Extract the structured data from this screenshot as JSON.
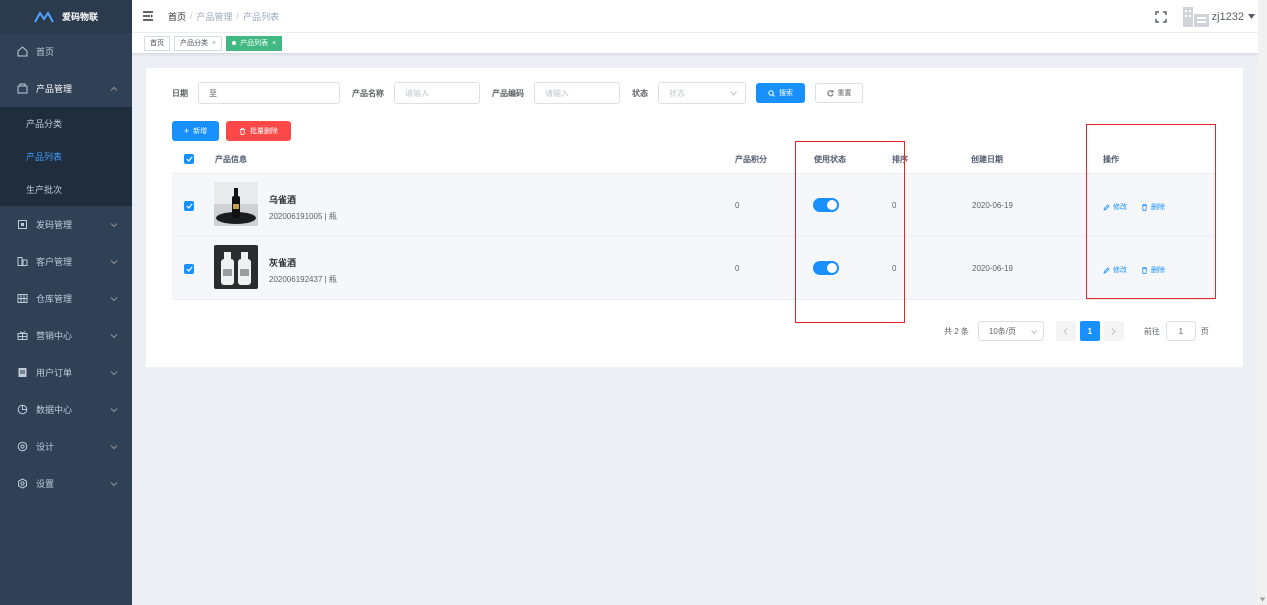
{
  "app": {
    "logo_text": "爱码物联"
  },
  "sidebar": {
    "items": [
      {
        "label": "首页",
        "icon": "home-icon"
      },
      {
        "label": "产品管理",
        "icon": "product-icon"
      },
      {
        "label": "发码管理",
        "icon": "code-icon"
      },
      {
        "label": "客户管理",
        "icon": "customer-icon"
      },
      {
        "label": "仓库管理",
        "icon": "warehouse-icon"
      },
      {
        "label": "营销中心",
        "icon": "marketing-icon"
      },
      {
        "label": "用户订单",
        "icon": "order-icon"
      },
      {
        "label": "数据中心",
        "icon": "data-icon"
      },
      {
        "label": "设计",
        "icon": "design-icon"
      },
      {
        "label": "设置",
        "icon": "settings-icon"
      }
    ],
    "sub_items": [
      {
        "label": "产品分类"
      },
      {
        "label": "产品列表"
      },
      {
        "label": "生产批次"
      }
    ]
  },
  "header": {
    "breadcrumb": [
      "首页",
      "产品管理",
      "产品列表"
    ],
    "separator": "/",
    "username": "zj1232"
  },
  "tags": [
    {
      "label": "首页"
    },
    {
      "label": "产品分类",
      "close": "×"
    },
    {
      "label": "产品列表",
      "close": "×"
    }
  ],
  "filters": {
    "date_label": "日期",
    "date_value": "至",
    "name_label": "产品名称",
    "name_placeholder": "请输入",
    "code_label": "产品编码",
    "code_placeholder": "请输入",
    "status_label": "状态",
    "status_placeholder": "状态",
    "search_label": "搜索",
    "reset_label": "重置"
  },
  "actions": {
    "add_label": "新增",
    "batch_delete_label": "批量删除"
  },
  "table": {
    "columns": [
      "产品信息",
      "产品积分",
      "使用状态",
      "排序",
      "创建日期",
      "操作"
    ],
    "rows": [
      {
        "name": "乌雀酒",
        "code": "202006191005 | 瓶",
        "points": "0",
        "enabled": true,
        "sort": "0",
        "date": "2020-06-19"
      },
      {
        "name": "灰雀酒",
        "code": "202006192437 | 瓶",
        "points": "0",
        "enabled": true,
        "sort": "0",
        "date": "2020-06-19"
      }
    ],
    "edit_label": "修改",
    "delete_label": "删除"
  },
  "pagination": {
    "total_text": "共 2 条",
    "page_size": "10条/页",
    "current_page": "1",
    "goto_label": "前往",
    "goto_value": "1",
    "page_suffix": "页"
  },
  "colors": {
    "sidebar_bg": "#304156",
    "primary": "#1890ff",
    "danger": "#ff4949",
    "tag_active": "#42b983",
    "highlight_box": "#e8262a"
  }
}
